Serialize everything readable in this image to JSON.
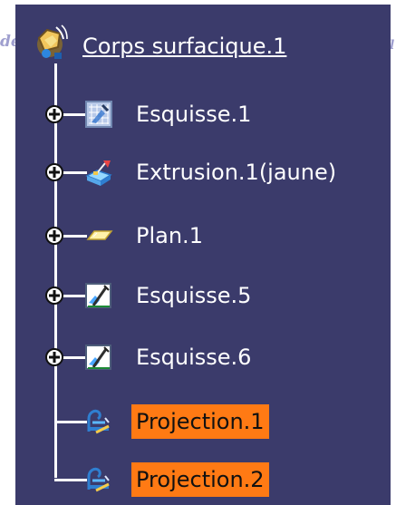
{
  "watermark_left": "de",
  "watermark_right": "l",
  "tree": {
    "root": {
      "label": "Corps surfacique.1",
      "icon": "surface-body-icon"
    },
    "items": [
      {
        "label": "Esquisse.1",
        "icon": "sketch-grid-icon",
        "expander": true,
        "selected": false
      },
      {
        "label": "Extrusion.1(jaune)",
        "icon": "extrusion-icon",
        "expander": true,
        "selected": false
      },
      {
        "label": "Plan.1",
        "icon": "plane-icon",
        "expander": true,
        "selected": false
      },
      {
        "label": "Esquisse.5",
        "icon": "sketch-icon",
        "expander": true,
        "selected": false
      },
      {
        "label": "Esquisse.6",
        "icon": "sketch-icon",
        "expander": true,
        "selected": false
      },
      {
        "label": "Projection.1",
        "icon": "projection-icon",
        "expander": false,
        "selected": true
      },
      {
        "label": "Projection.2",
        "icon": "projection-icon",
        "expander": false,
        "selected": true
      }
    ]
  },
  "colors": {
    "panel_background": "#3b3b6b",
    "tree_line": "#ffffff",
    "selection_highlight": "#ff7a14"
  }
}
